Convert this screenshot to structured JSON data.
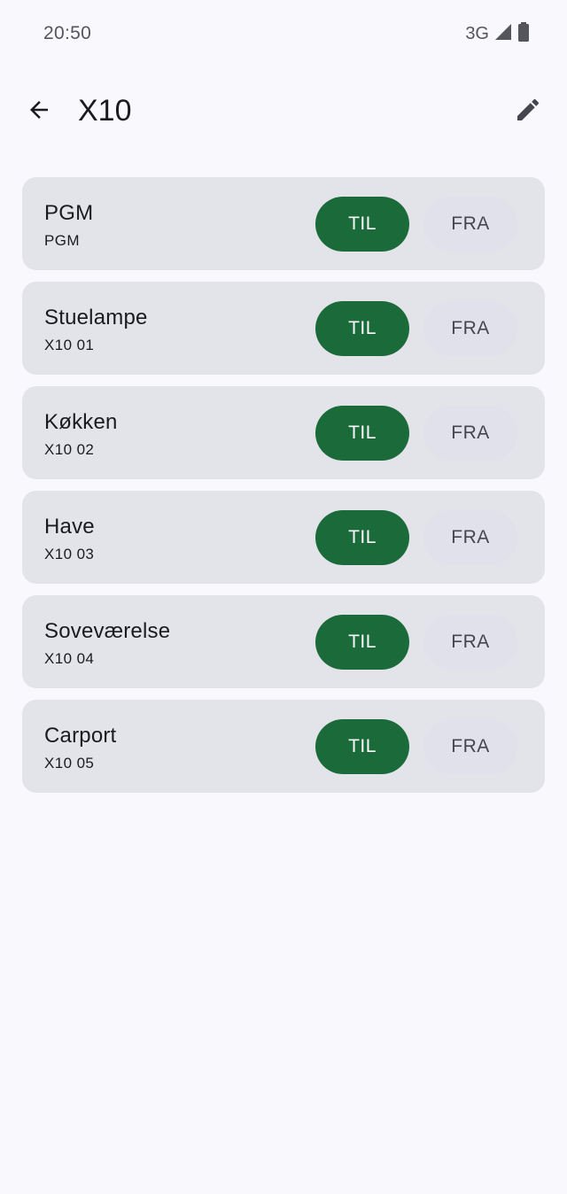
{
  "status_bar": {
    "time": "20:50",
    "network": "3G",
    "icons": [
      "signal-icon",
      "battery-icon"
    ]
  },
  "app_bar": {
    "title": "X10",
    "back_icon": "arrow-back-icon",
    "edit_icon": "pencil-icon"
  },
  "devices": [
    {
      "name": "PGM",
      "address": "PGM",
      "on_label": "TIL",
      "off_label": "FRA"
    },
    {
      "name": "Stuelampe",
      "address": "X10 01",
      "on_label": "TIL",
      "off_label": "FRA"
    },
    {
      "name": "Køkken",
      "address": "X10 02",
      "on_label": "TIL",
      "off_label": "FRA"
    },
    {
      "name": "Have",
      "address": "X10 03",
      "on_label": "TIL",
      "off_label": "FRA"
    },
    {
      "name": "Soveværelse",
      "address": "X10 04",
      "on_label": "TIL",
      "off_label": "FRA"
    },
    {
      "name": "Carport",
      "address": "X10 05",
      "on_label": "TIL",
      "off_label": "FRA"
    }
  ],
  "colors": {
    "background": "#f8f8fd",
    "card": "#e3e3ea",
    "on_button": "#1b6b3a",
    "on_text": "#ffffff",
    "off_text": "#45464f"
  }
}
